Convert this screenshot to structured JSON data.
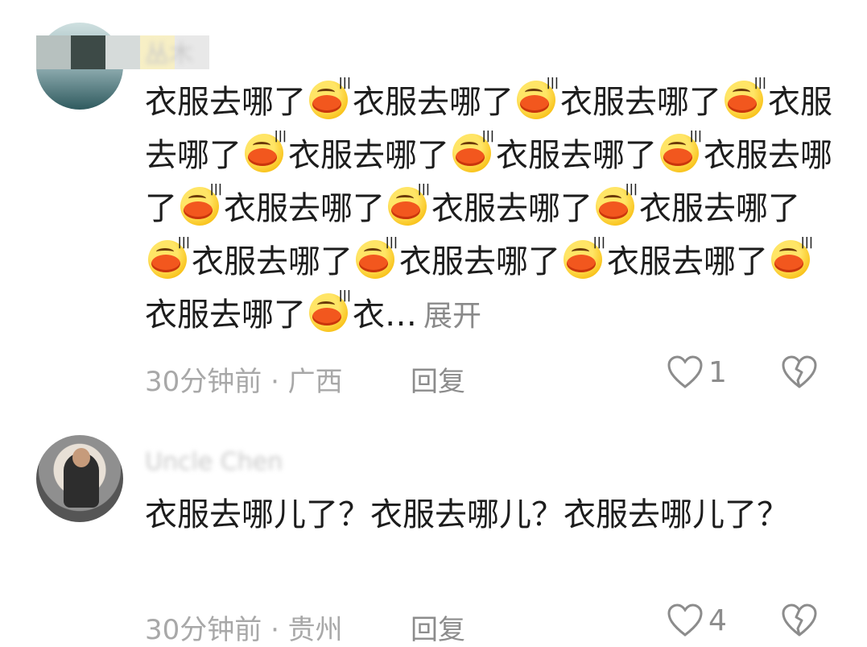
{
  "comments": [
    {
      "username": "丛木",
      "text_unit": "衣服去哪了",
      "emoji": "lip-kiss-emoji",
      "expand_label": "展开",
      "truncated_tail": "衣…",
      "time": "30分钟前",
      "location": "广西",
      "time_location": "30分钟前 · 广西",
      "reply_label": "回复",
      "like_count": "1"
    },
    {
      "username": "Uncle Chen",
      "text": "衣服去哪儿了？衣服去哪儿？衣服去哪儿了？",
      "time_location": "30分钟前 · 贵州",
      "reply_label": "回复",
      "like_count": "4"
    }
  ],
  "colors": {
    "text": "#1c1c1c",
    "meta": "#a8a8a8",
    "icon": "#8c8c8c"
  }
}
